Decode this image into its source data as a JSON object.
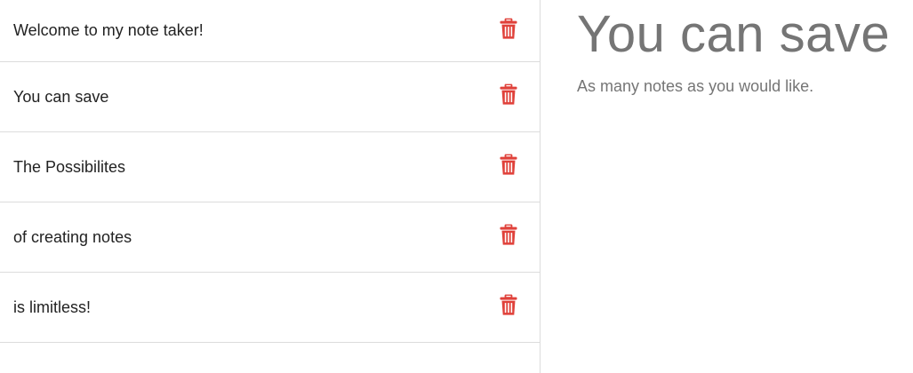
{
  "notes": [
    {
      "title": "Welcome to my note taker!",
      "delete_icon": "trash-icon"
    },
    {
      "title": "You can save",
      "delete_icon": "trash-icon"
    },
    {
      "title": "The Possibilites",
      "delete_icon": "trash-icon"
    },
    {
      "title": "of creating notes",
      "delete_icon": "trash-icon"
    },
    {
      "title": "is limitless!",
      "delete_icon": "trash-icon"
    }
  ],
  "active_note": {
    "title": "You can save",
    "text": "As many notes as you would like."
  },
  "colors": {
    "delete": "#e0413a",
    "text_dark": "#222222",
    "text_muted": "#757575",
    "divider": "#dcdcdc"
  }
}
